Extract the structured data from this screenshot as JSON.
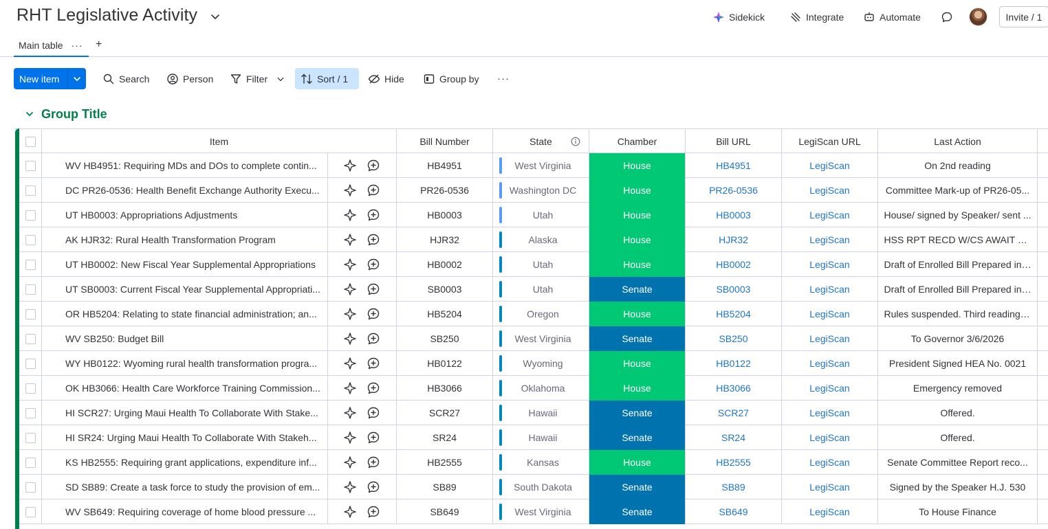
{
  "board": {
    "title": "RHT Legislative Activity"
  },
  "header_actions": {
    "sidekick": "Sidekick",
    "integrate": "Integrate",
    "automate": "Automate",
    "invite": "Invite / 1"
  },
  "tabs": {
    "main": "Main table",
    "more": "···",
    "add": "+"
  },
  "toolbar": {
    "new_item": "New item",
    "search": "Search",
    "person": "Person",
    "filter": "Filter",
    "sort": "Sort / 1",
    "hide": "Hide",
    "group_by": "Group by",
    "more": "···"
  },
  "group": {
    "title": "Group Title",
    "color": "#037f4c"
  },
  "columns": {
    "item": "Item",
    "bill_number": "Bill Number",
    "state": "State",
    "chamber": "Chamber",
    "bill_url": "Bill URL",
    "legiscan_url": "LegiScan URL",
    "last_action": "Last Action"
  },
  "colors": {
    "house": "#00c875",
    "senate": "#0073ae",
    "accent": "#0073ea",
    "link": "#1f76c2"
  },
  "rows": [
    {
      "item": "WV HB4951: Requiring MDs and DOs to complete contin...",
      "bill": "HB4951",
      "state": "West Virginia",
      "chamber": "House",
      "url": "HB4951",
      "legiscan": "LegiScan",
      "last": "On 2nd reading",
      "bar": "#579bfc"
    },
    {
      "item": "DC PR26-0536: Health Benefit Exchange Authority Execu...",
      "bill": "PR26-0536",
      "state": "Washington DC",
      "chamber": "House",
      "url": "PR26-0536",
      "legiscan": "LegiScan",
      "last": "Committee Mark-up of PR26-05...",
      "bar": "#579bfc"
    },
    {
      "item": "UT HB0003: Appropriations Adjustments",
      "bill": "HB0003",
      "state": "Utah",
      "chamber": "House",
      "url": "HB0003",
      "legiscan": "LegiScan",
      "last": "House/ signed by Speaker/ sent ...",
      "bar": "#579bfc"
    },
    {
      "item": "AK HJR32: Rural Health Transformation Program",
      "bill": "HJR32",
      "state": "Alaska",
      "chamber": "House",
      "url": "HJR32",
      "legiscan": "LegiScan",
      "last": "HSS RPT RECD W/CS AWAIT TR...",
      "bar": "#0086c0"
    },
    {
      "item": "UT HB0002: New Fiscal Year Supplemental Appropriations",
      "bill": "HB0002",
      "state": "Utah",
      "chamber": "House",
      "url": "HB0002",
      "legiscan": "LegiScan",
      "last": "Draft of Enrolled Bill Prepared in ...",
      "bar": "#0086c0"
    },
    {
      "item": "UT SB0003: Current Fiscal Year Supplemental Appropriati...",
      "bill": "SB0003",
      "state": "Utah",
      "chamber": "Senate",
      "url": "SB0003",
      "legiscan": "LegiScan",
      "last": "Draft of Enrolled Bill Prepared in ...",
      "bar": "#0086c0"
    },
    {
      "item": "OR HB5204: Relating to state financial administration; an...",
      "bill": "HB5204",
      "state": "Oregon",
      "chamber": "House",
      "url": "HB5204",
      "legiscan": "LegiScan",
      "last": "Rules suspended. Third reading. ...",
      "bar": "#0086c0"
    },
    {
      "item": "WV SB250: Budget Bill",
      "bill": "SB250",
      "state": "West Virginia",
      "chamber": "Senate",
      "url": "SB250",
      "legiscan": "LegiScan",
      "last": "To Governor 3/6/2026",
      "bar": "#0086c0"
    },
    {
      "item": "WY HB0122: Wyoming rural health transformation progra...",
      "bill": "HB0122",
      "state": "Wyoming",
      "chamber": "House",
      "url": "HB0122",
      "legiscan": "LegiScan",
      "last": "President Signed HEA No. 0021",
      "bar": "#0086c0"
    },
    {
      "item": "OK HB3066: Health Care Workforce Training Commission...",
      "bill": "HB3066",
      "state": "Oklahoma",
      "chamber": "House",
      "url": "HB3066",
      "legiscan": "LegiScan",
      "last": "Emergency removed",
      "bar": "#0086c0"
    },
    {
      "item": "HI SCR27: Urging Maui Health To Collaborate With Stake...",
      "bill": "SCR27",
      "state": "Hawaii",
      "chamber": "Senate",
      "url": "SCR27",
      "legiscan": "LegiScan",
      "last": "Offered.",
      "bar": "#0086c0"
    },
    {
      "item": "HI SR24: Urging Maui Health To Collaborate With Stakeh...",
      "bill": "SR24",
      "state": "Hawaii",
      "chamber": "Senate",
      "url": "SR24",
      "legiscan": "LegiScan",
      "last": "Offered.",
      "bar": "#0086c0"
    },
    {
      "item": "KS HB2555: Requiring grant applications, expenditure inf...",
      "bill": "HB2555",
      "state": "Kansas",
      "chamber": "House",
      "url": "HB2555",
      "legiscan": "LegiScan",
      "last": "Senate Committee Report reco...",
      "bar": "#0086c0"
    },
    {
      "item": "SD SB89: Create a task force to study the provision of em...",
      "bill": "SB89",
      "state": "South Dakota",
      "chamber": "Senate",
      "url": "SB89",
      "legiscan": "LegiScan",
      "last": "Signed by the Speaker H.J. 530",
      "bar": "#0086c0"
    },
    {
      "item": "WV SB649: Requiring coverage of home blood pressure ...",
      "bill": "SB649",
      "state": "West Virginia",
      "chamber": "Senate",
      "url": "SB649",
      "legiscan": "LegiScan",
      "last": "To House Finance",
      "bar": "#0086c0"
    }
  ]
}
